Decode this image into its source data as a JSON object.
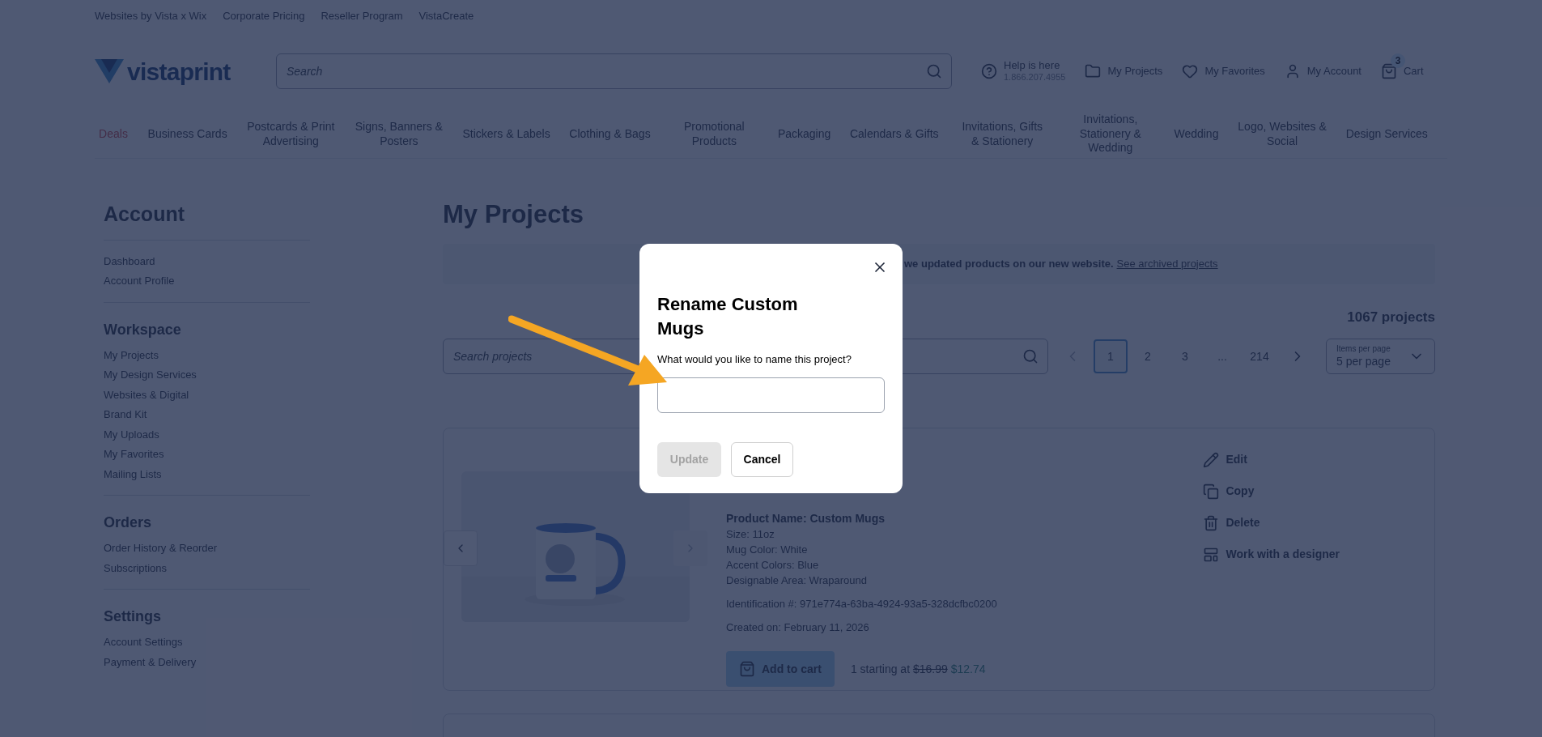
{
  "top_links": [
    {
      "label": "Websites by Vista x Wix"
    },
    {
      "label": "Corporate Pricing"
    },
    {
      "label": "Reseller Program"
    },
    {
      "label": "VistaCreate"
    }
  ],
  "header": {
    "logo": "vistaprint",
    "search_placeholder": "Search",
    "help": {
      "title": "Help is here",
      "phone": "1.866.207.4955"
    },
    "links": [
      {
        "label": "My Projects",
        "kind": "folder"
      },
      {
        "label": "My Favorites",
        "kind": "heart"
      },
      {
        "label": "My Account",
        "kind": "user"
      }
    ],
    "cart": {
      "label": "Cart",
      "count": "3"
    }
  },
  "nav": [
    {
      "label": "Deals",
      "highlighted": true
    },
    {
      "label": "Business Cards",
      "highlighted": false
    },
    {
      "label": "Postcards & Print Advertising",
      "highlighted": false
    },
    {
      "label": "Signs, Banners & Posters",
      "highlighted": false
    },
    {
      "label": "Stickers & Labels",
      "highlighted": false
    },
    {
      "label": "Clothing & Bags",
      "highlighted": false
    },
    {
      "label": "Promotional Products",
      "highlighted": false
    },
    {
      "label": "Packaging",
      "highlighted": false
    },
    {
      "label": "Calendars & Gifts",
      "highlighted": false
    },
    {
      "label": "Invitations, Gifts & Stationery",
      "highlighted": false
    },
    {
      "label": "Invitations, Stationery & Wedding",
      "highlighted": false
    },
    {
      "label": "Wedding",
      "highlighted": false
    },
    {
      "label": "Logo, Websites & Social",
      "highlighted": false
    },
    {
      "label": "Design Services",
      "highlighted": false
    }
  ],
  "sidebar": {
    "title": "Account",
    "sections": [
      {
        "items": [
          "Dashboard",
          "Account Profile"
        ]
      },
      {
        "heading": "Workspace",
        "items": [
          "My Projects",
          "My Design Services",
          "Websites & Digital",
          "Brand Kit",
          "My Uploads",
          "My Favorites",
          "Mailing Lists"
        ]
      },
      {
        "heading": "Orders",
        "items": [
          "Order History & Reorder",
          "Subscriptions"
        ]
      },
      {
        "heading": "Settings",
        "items": [
          "Account Settings",
          "Payment & Delivery"
        ]
      }
    ]
  },
  "main": {
    "title": "My Projects",
    "banner": {
      "text": "we updated products on our new website.",
      "link": "See archived projects"
    },
    "count": "1067 projects",
    "search_placeholder": "Search projects",
    "pagination": [
      {
        "label": "1",
        "selected": true
      },
      {
        "label": "2",
        "selected": false
      },
      {
        "label": "3",
        "selected": false
      },
      {
        "label": "...",
        "selected": false
      },
      {
        "label": "214",
        "selected": false
      }
    ],
    "per_page": {
      "label": "Items per page",
      "value": "5 per page"
    },
    "project": {
      "product_name": "Product Name: Custom Mugs",
      "specs": [
        "Size: 11oz",
        "Mug Color: White",
        "Accent Colors: Blue",
        "Designable Area: Wraparound"
      ],
      "identification": "Identification #: 971e774a-63ba-4924-93a5-328dcfbc0200",
      "created": "Created on: February 11, 2026",
      "add_to_cart": "Add to cart",
      "price": {
        "prefix": "1 starting at",
        "old": "$16.99",
        "new": "$12.74"
      },
      "actions": [
        {
          "label": "Edit",
          "kind": "edit"
        },
        {
          "label": "Copy",
          "kind": "copy"
        },
        {
          "label": "Delete",
          "kind": "delete"
        },
        {
          "label": "Work with a designer",
          "kind": "designer"
        }
      ]
    }
  },
  "dialog": {
    "title": "Rename Custom Mugs",
    "question": "What would you like to name this project?",
    "buttons": [
      {
        "label": "Update",
        "kind": "primary",
        "disabled": true
      },
      {
        "label": "Cancel",
        "kind": "secondary",
        "disabled": false
      }
    ]
  }
}
